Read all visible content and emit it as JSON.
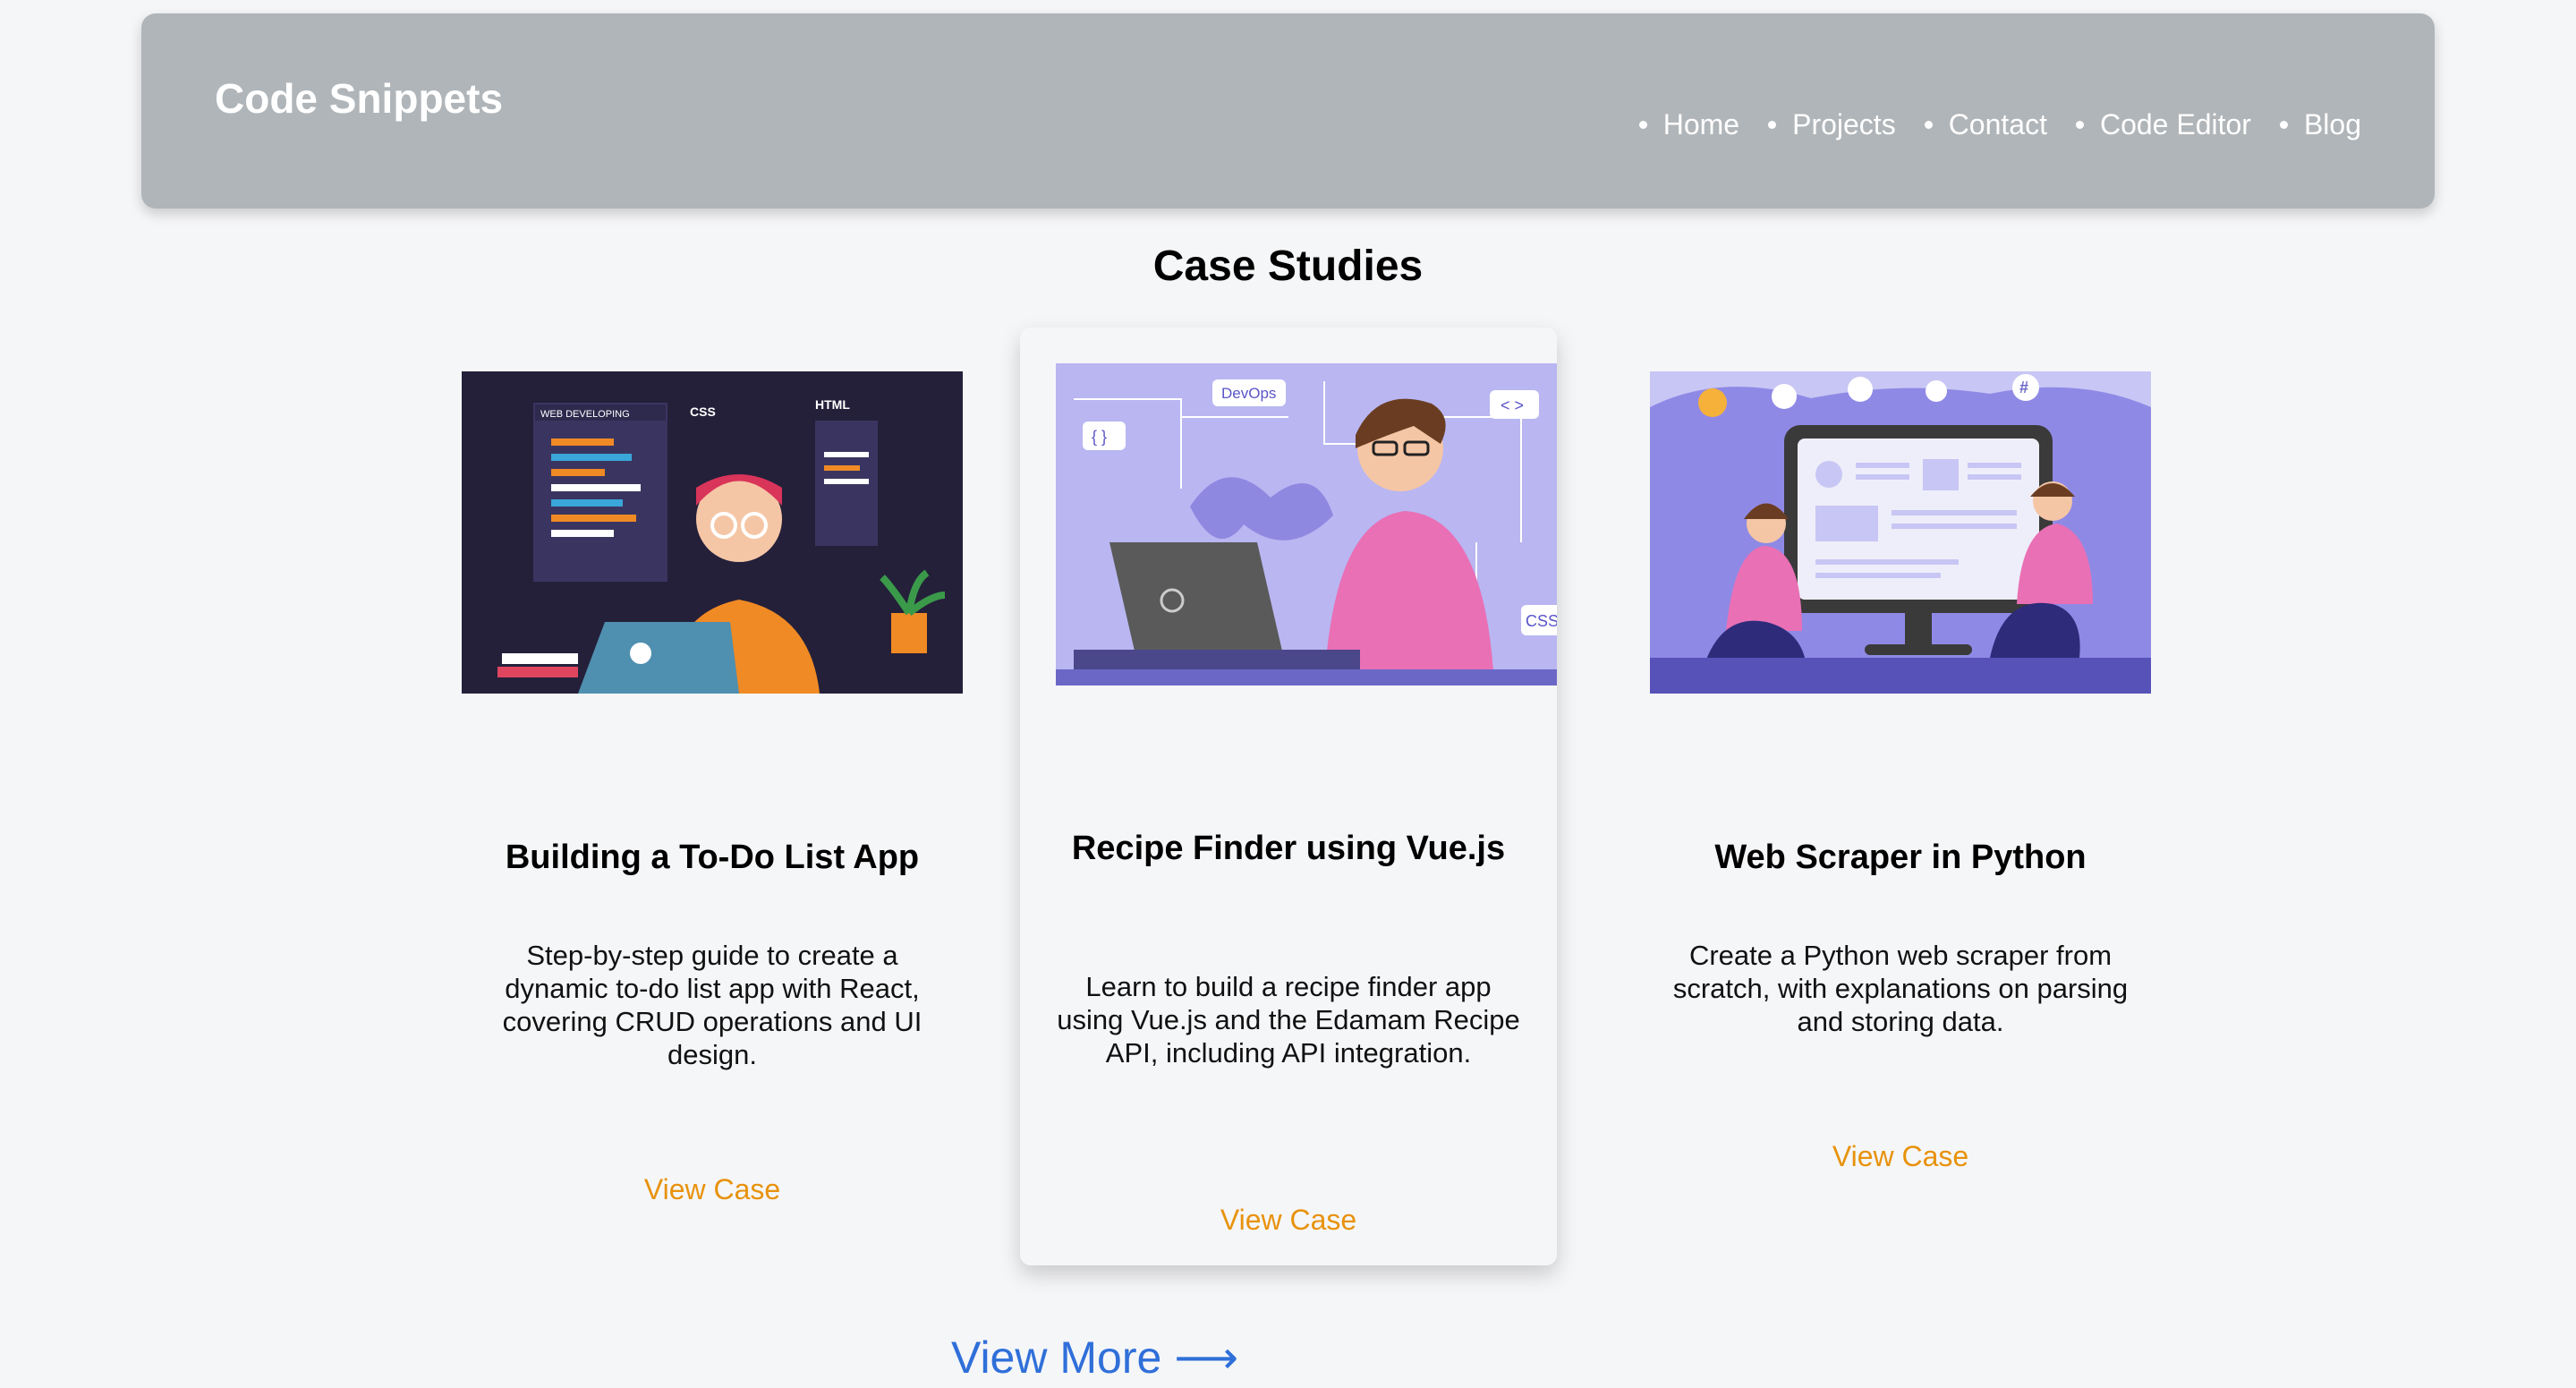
{
  "header": {
    "brand": "Code Snippets",
    "nav": [
      "Home",
      "Projects",
      "Contact",
      "Code Editor",
      "Blog"
    ]
  },
  "section": {
    "title": "Case Studies"
  },
  "cards": [
    {
      "title": "Building a To-Do List App",
      "description": "Step-by-step guide to create a dynamic to-do list app with React, covering CRUD operations and UI design.",
      "link": "View Case",
      "image_labels": [
        "WEB DEVELOPING",
        "CSS",
        "HTML"
      ]
    },
    {
      "title": "Recipe Finder using Vue.js",
      "description": "Learn to build a recipe finder app using Vue.js and the Edamam Recipe API, including API integration.",
      "link": "View Case",
      "image_labels": [
        "DevOps",
        "{ }",
        "< >",
        "CSS"
      ]
    },
    {
      "title": "Web Scraper in Python",
      "description": "Create a Python web scraper from scratch, with explanations on parsing and storing data.",
      "link": "View Case",
      "image_labels": [
        "#"
      ]
    }
  ],
  "footer": {
    "view_more": "View More",
    "arrow": "⟶"
  },
  "colors": {
    "header_bg": "#b0b5b9",
    "page_bg": "#f5f6f8",
    "link_orange": "#e8920c",
    "view_more_blue": "#2f6fd9"
  }
}
